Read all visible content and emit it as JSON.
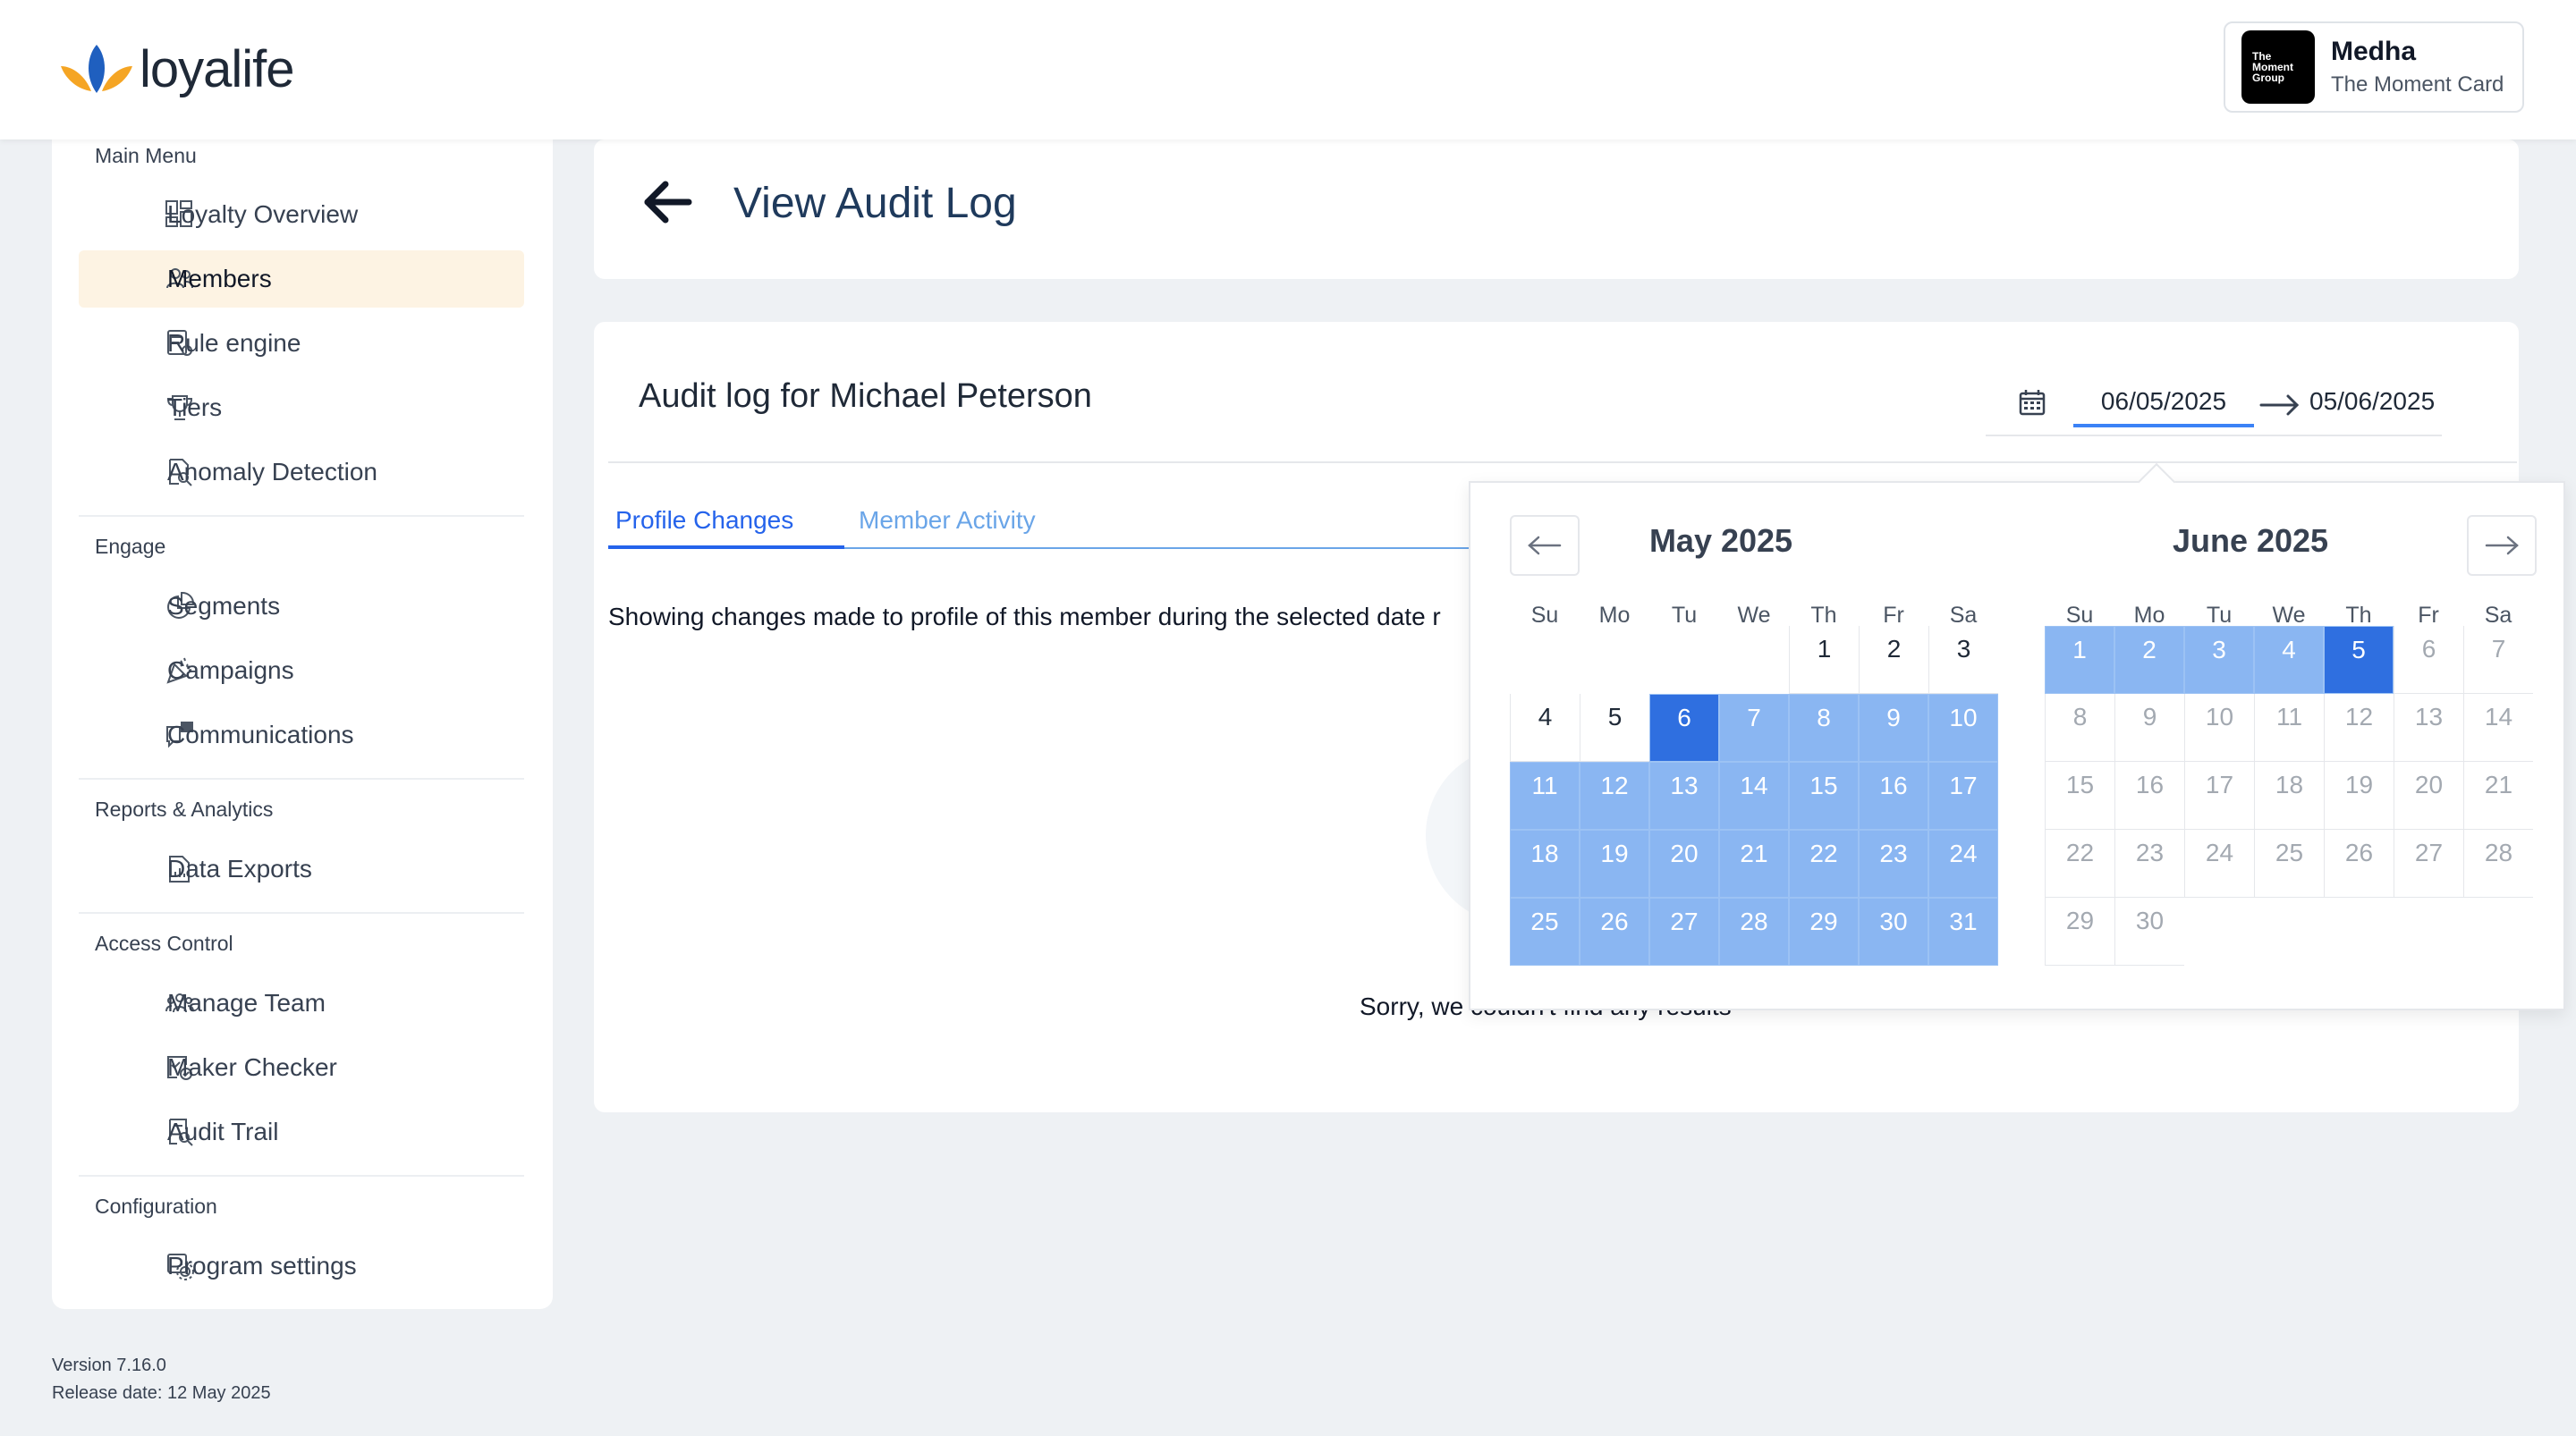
{
  "header": {
    "logo_text": "loyalife",
    "profile": {
      "logo_text": [
        "The",
        "Moment",
        "Group"
      ],
      "name": "Medha",
      "program": "The Moment Card"
    }
  },
  "sidebar": {
    "sections": {
      "main_menu": "Main Menu",
      "engage": "Engage",
      "reports": "Reports & Analytics",
      "access": "Access Control",
      "config": "Configuration"
    },
    "items": {
      "loyalty_overview": "Loyalty Overview",
      "members": "Members",
      "rule_engine": "Rule engine",
      "tiers": "Tiers",
      "anomaly": "Anomaly Detection",
      "segments": "Segments",
      "campaigns": "Campaigns",
      "communications": "Communications",
      "data_exports": "Data Exports",
      "manage_team": "Manage Team",
      "maker_checker": "Maker Checker",
      "audit_trail": "Audit Trail",
      "program_settings": "Program settings"
    },
    "active_item": "Members",
    "version": "Version 7.16.0",
    "release_date": "Release date: 12 May 2025"
  },
  "page": {
    "title": "View Audit Log",
    "audit_title": "Audit log for Michael Peterson",
    "date_start": "06/05/2025",
    "date_end": "05/06/2025",
    "tabs": {
      "profile": "Profile Changes",
      "activity": "Member Activity"
    },
    "active_tab": "Profile Changes",
    "description": "Showing changes made to profile of this member during the selected date r",
    "empty_message": "Sorry, we couldn't find any results"
  },
  "calendar": {
    "left_month": "May 2025",
    "right_month": "June 2025",
    "weekdays": [
      "Su",
      "Mo",
      "Tu",
      "We",
      "Th",
      "Fr",
      "Sa"
    ],
    "range_start_day": "6",
    "range_end_day": "5"
  },
  "colors": {
    "accent": "#2563eb",
    "range_fill": "#8ab6f2",
    "range_edge": "#2f6fe0",
    "active_nav_bg": "#fdf3e3"
  }
}
